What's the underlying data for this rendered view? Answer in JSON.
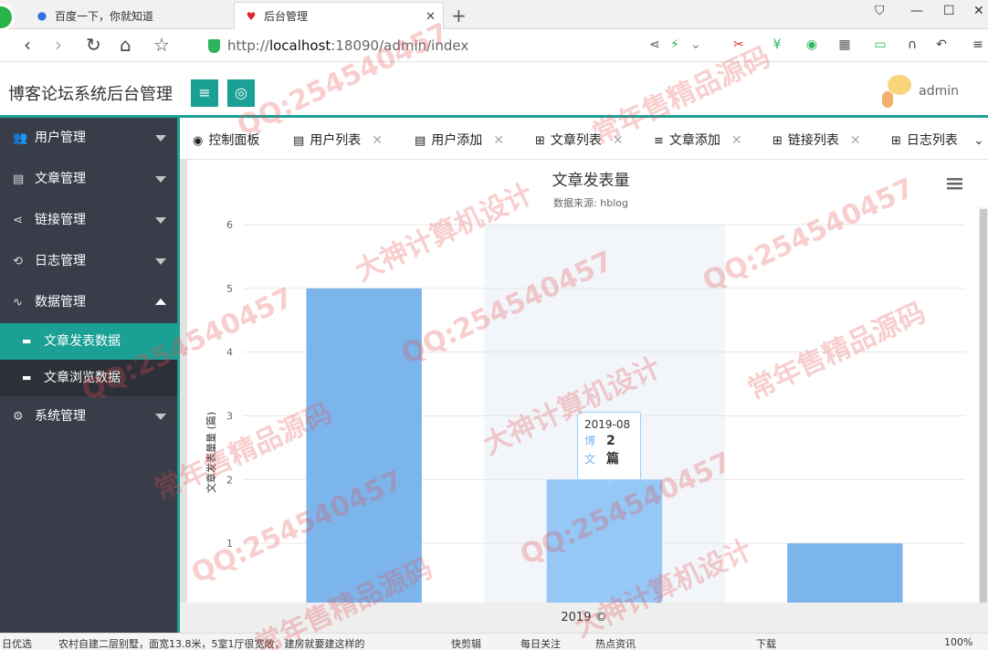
{
  "browser": {
    "tabs": [
      {
        "title": "百度一下，你就知道",
        "icon": "paw-icon"
      },
      {
        "title": "后台管理",
        "icon": "heart-icon"
      }
    ],
    "url_prefix": "http://",
    "url_host": "localhost",
    "url_rest": ":18090/admin/index"
  },
  "header": {
    "app_name": "博客论坛系统后台管理",
    "user_name": "admin",
    "accent": "#1aa094"
  },
  "sidebar": {
    "items": [
      {
        "label": "用户管理",
        "icon": "users-icon"
      },
      {
        "label": "文章管理",
        "icon": "document-icon"
      },
      {
        "label": "链接管理",
        "icon": "share-icon"
      },
      {
        "label": "日志管理",
        "icon": "log-icon"
      },
      {
        "label": "数据管理",
        "icon": "pulse-icon"
      },
      {
        "label": "系统管理",
        "icon": "gears-icon"
      }
    ],
    "subitems": [
      {
        "label": "文章发表数据",
        "active": true
      },
      {
        "label": "文章浏览数据",
        "active": false
      }
    ]
  },
  "content_tabs": [
    {
      "label": "控制面板",
      "icon": "dashboard-icon"
    },
    {
      "label": "用户列表",
      "icon": "list-icon"
    },
    {
      "label": "用户添加",
      "icon": "list-icon"
    },
    {
      "label": "文章列表",
      "icon": "table-icon"
    },
    {
      "label": "文章添加",
      "icon": "menu-icon"
    },
    {
      "label": "链接列表",
      "icon": "table-icon"
    },
    {
      "label": "日志列表",
      "icon": "table-icon"
    }
  ],
  "chart_data": {
    "type": "bar",
    "title": "文章发表量",
    "subtitle": "数据来源: hblog",
    "ylabel": "文章发表量量 (篇)",
    "categories": [
      "",
      "2019-08",
      ""
    ],
    "values": [
      5,
      2,
      1
    ],
    "ylim": [
      0,
      6
    ],
    "yticks": [
      1,
      2,
      3,
      4,
      5,
      6
    ],
    "grid": true,
    "bar_color": "#7cb5ec",
    "hover_index": 1
  },
  "tooltip": {
    "date": "2019-08",
    "series_name_1": "博",
    "series_name_2": "文",
    "value_1": "2",
    "value_2": "篇"
  },
  "footer": {
    "text": "2019 ©"
  },
  "statusbar": {
    "items": [
      "日优选",
      "农村自建二层别墅，面宽13.8米，5室1厅很宽敞，建房就要建这样的",
      "快剪辑",
      "每日关注",
      "热点资讯",
      "下载",
      "100%"
    ]
  },
  "watermarks": [
    "QQ:254540457",
    "大神计算机设计",
    "常年售精品源码"
  ]
}
